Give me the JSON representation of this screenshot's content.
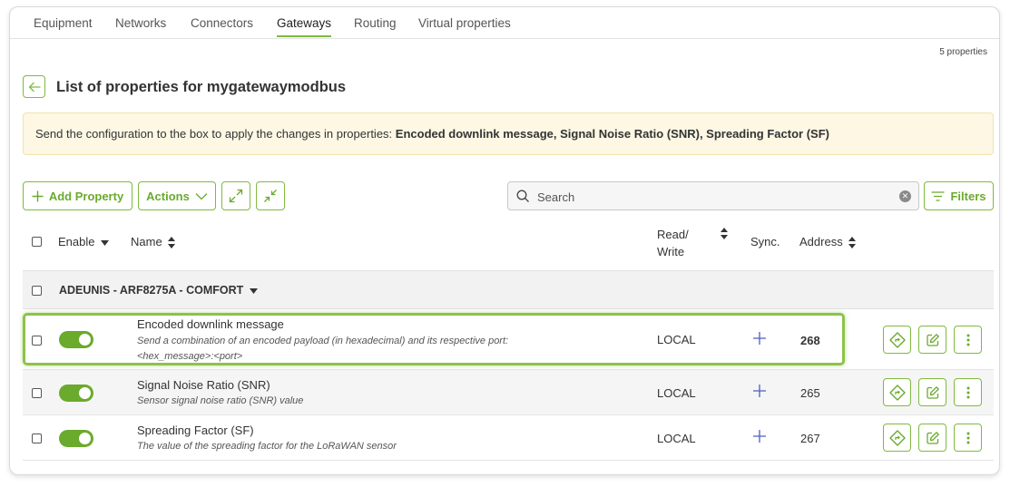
{
  "tabs": [
    "Equipment",
    "Networks",
    "Connectors",
    "Gateways",
    "Routing",
    "Virtual properties"
  ],
  "active_tab": "Gateways",
  "property_count": "5 properties",
  "page_title": "List of properties for mygatewaymodbus",
  "notice": {
    "prefix": "Send the configuration to the box to apply the changes in properties: ",
    "emphasis": "Encoded downlink message, Signal Noise Ratio (SNR), Spreading Factor (SF)"
  },
  "toolbar": {
    "add_property": "Add Property",
    "actions": "Actions",
    "filters": "Filters"
  },
  "search": {
    "placeholder": "Search",
    "value": ""
  },
  "columns": {
    "enable": "Enable",
    "name": "Name",
    "read_write_line1": "Read/",
    "read_write_line2": "Write",
    "sync": "Sync.",
    "address": "Address"
  },
  "group": {
    "label": "ADEUNIS - ARF8275A - COMFORT"
  },
  "rows": [
    {
      "name": "Encoded downlink message",
      "description_line1": "Send a combination of an encoded payload (in hexadecimal) and its respective port:",
      "description_line2": "<hex_message>:<port>",
      "read_write": "LOCAL",
      "address": "268",
      "enabled": true,
      "highlighted": true
    },
    {
      "name": "Signal Noise Ratio (SNR)",
      "description_line1": "Sensor signal noise ratio (SNR) value",
      "read_write": "LOCAL",
      "address": "265",
      "enabled": true
    },
    {
      "name": "Spreading Factor (SF)",
      "description_line1": "The value of the spreading factor for the LoRaWAN sensor",
      "read_write": "LOCAL",
      "address": "267",
      "enabled": true
    }
  ],
  "colors": {
    "accent": "#7fba3e",
    "toggle_on": "#6aaa2c",
    "notice_bg": "#fdf7e4",
    "sync_plus": "#4a5fc1"
  }
}
